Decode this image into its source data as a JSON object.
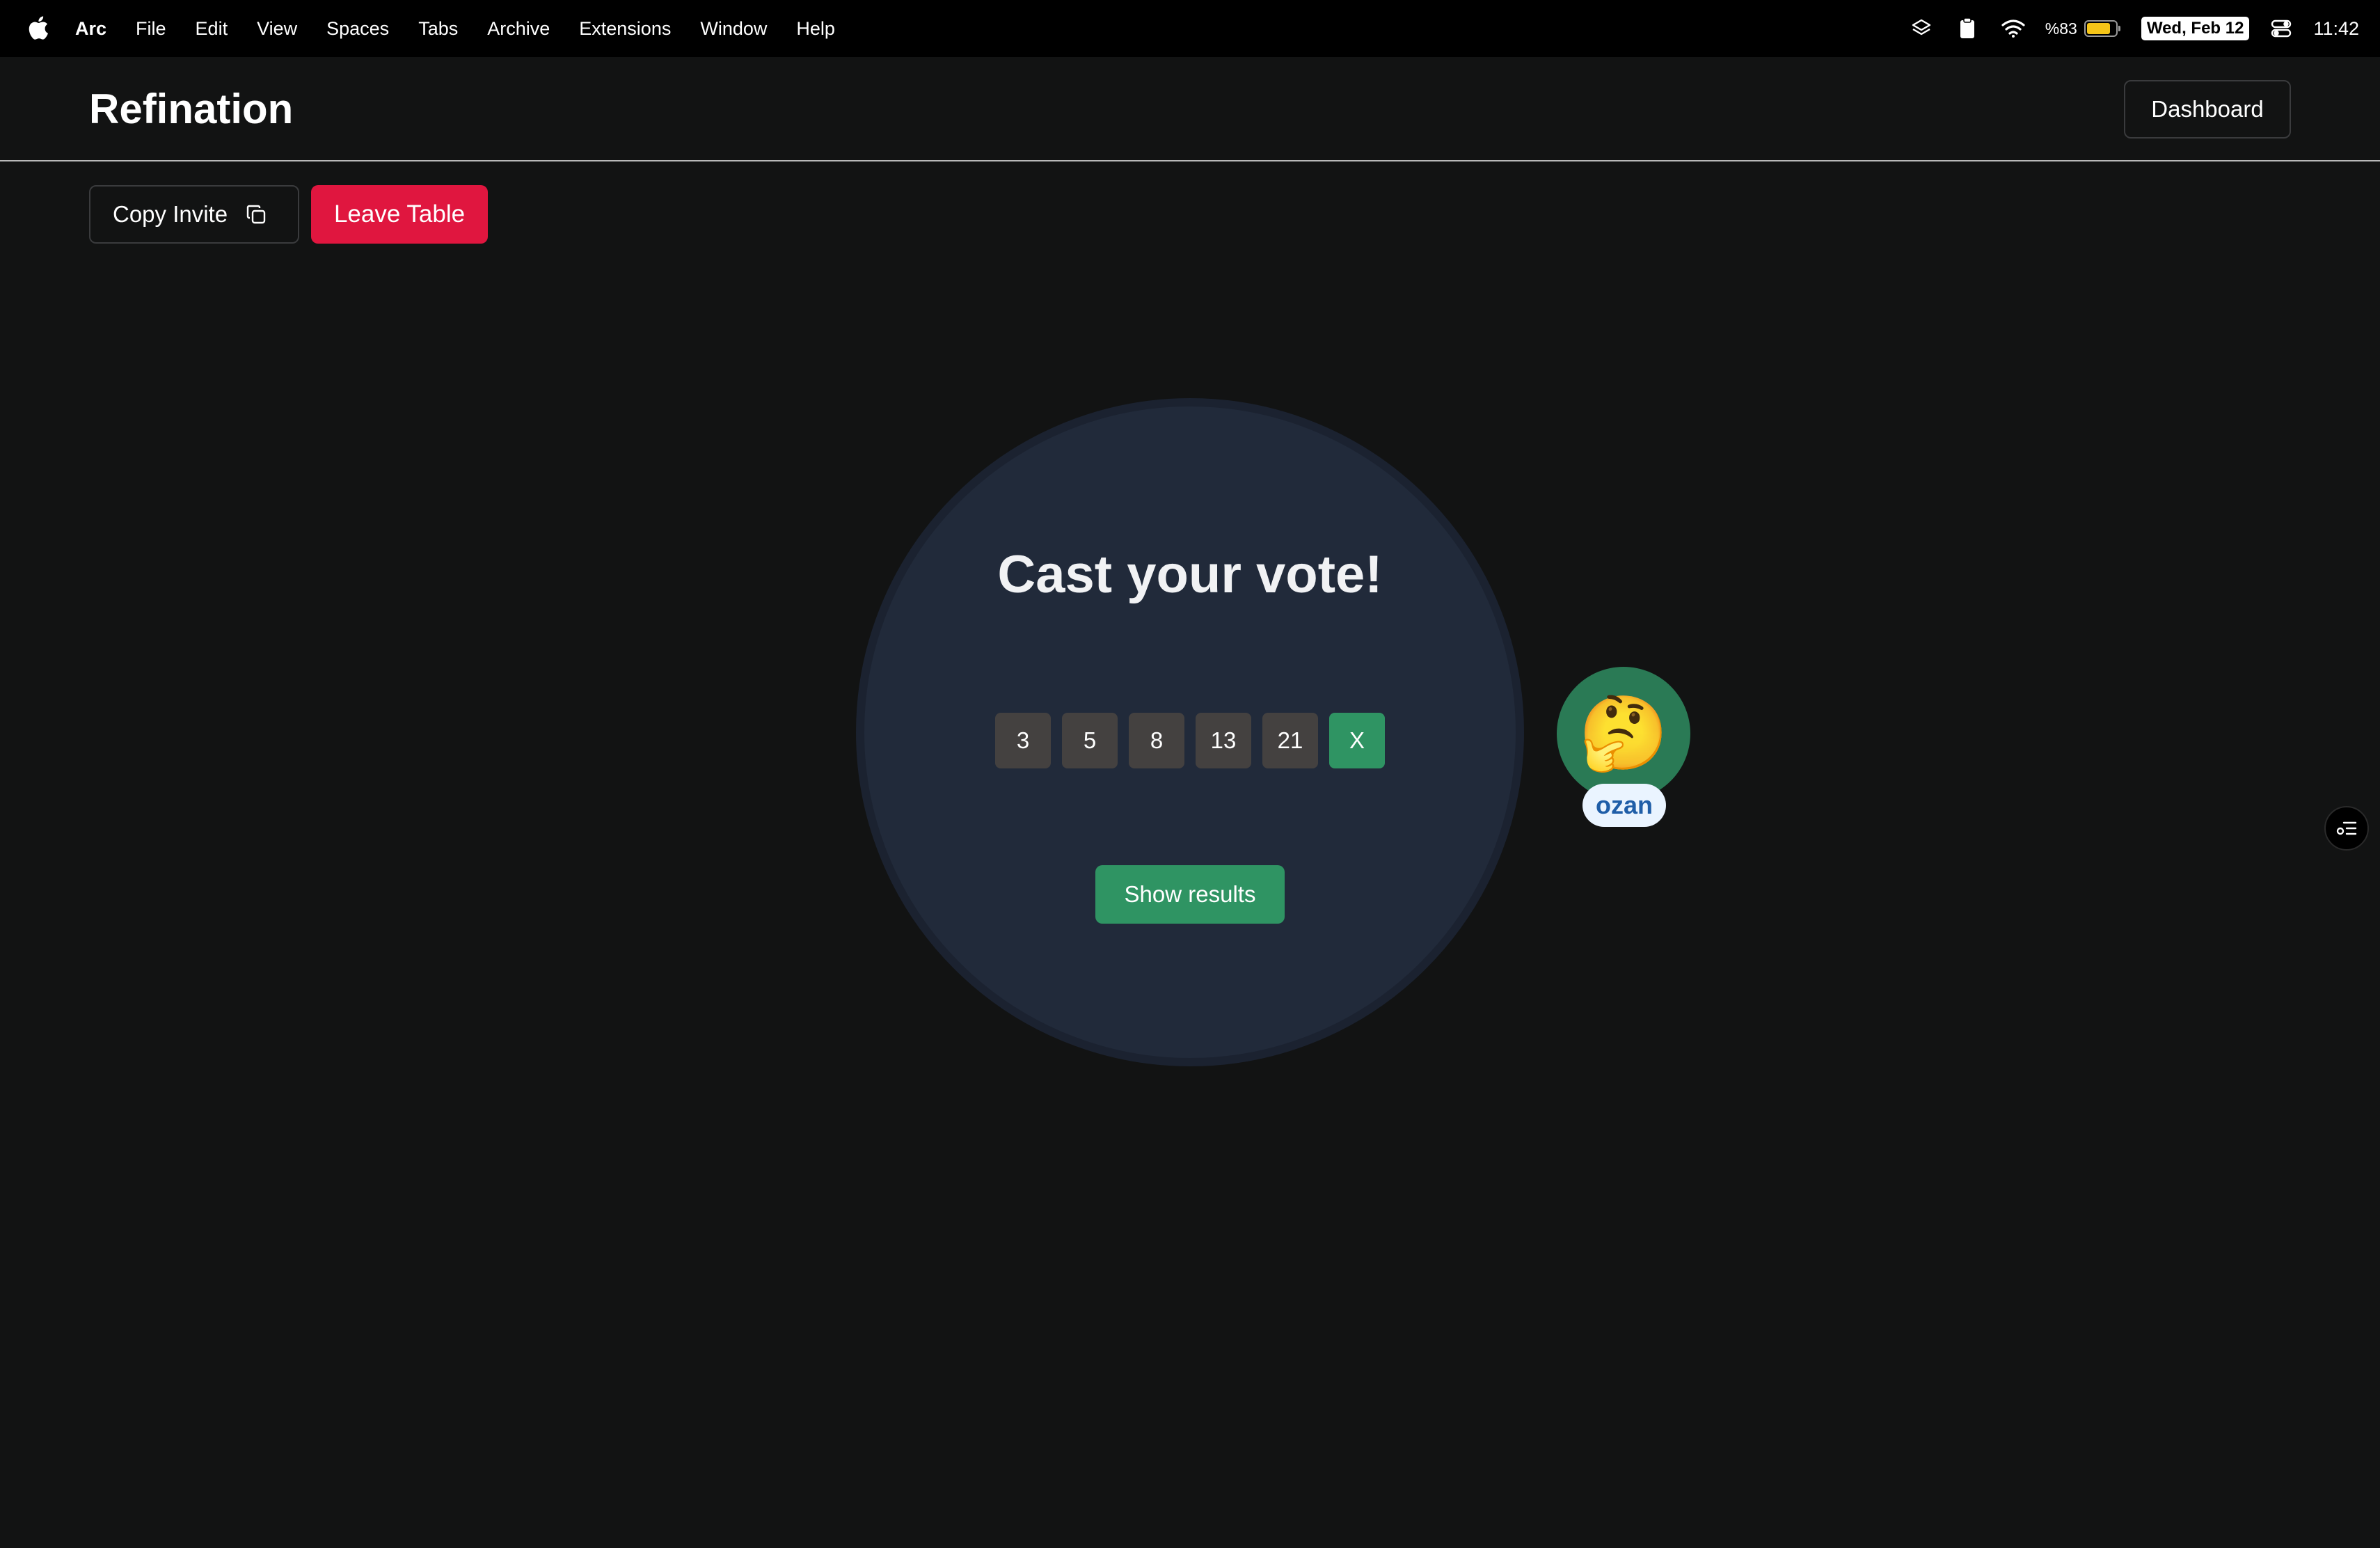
{
  "menubar": {
    "app_name": "Arc",
    "menus": [
      "File",
      "Edit",
      "View",
      "Spaces",
      "Tabs",
      "Archive",
      "Extensions",
      "Window",
      "Help"
    ],
    "battery_text": "%83",
    "battery_level": 0.83,
    "date": "Wed, Feb 12",
    "time": "11:42"
  },
  "header": {
    "title": "Refination",
    "dashboard_label": "Dashboard"
  },
  "toolbar": {
    "copy_invite_label": "Copy Invite",
    "leave_table_label": "Leave Table"
  },
  "table": {
    "title": "Cast your vote!",
    "cards": [
      "3",
      "5",
      "8",
      "13",
      "21",
      "X"
    ],
    "selected_card": "X",
    "show_results_label": "Show results"
  },
  "player": {
    "emoji": "🤔",
    "name": "ozan"
  },
  "colors": {
    "background": "#121313",
    "danger": "#e0163f",
    "accent_green": "#2f9463",
    "table": "#212a3a"
  }
}
